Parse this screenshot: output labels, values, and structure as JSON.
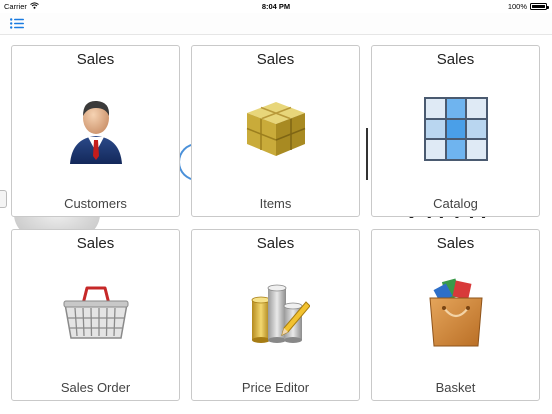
{
  "status_bar": {
    "carrier": "Carrier",
    "wifi_icon": "wifi-icon",
    "time": "8:04 PM",
    "battery_text": "100%",
    "battery_level": 1.0
  },
  "nav": {
    "menu_icon": "list-icon",
    "accent_color": "#1a7be0"
  },
  "background": {
    "year_text": "2016"
  },
  "tiles": [
    {
      "title": "Sales",
      "label": "Customers",
      "icon": "customer-icon"
    },
    {
      "title": "Sales",
      "label": "Items",
      "icon": "box-icon"
    },
    {
      "title": "Sales",
      "label": "Catalog",
      "icon": "catalog-grid-icon"
    },
    {
      "title": "Sales",
      "label": "Sales Order",
      "icon": "basket-icon"
    },
    {
      "title": "Sales",
      "label": "Price Editor",
      "icon": "coins-pencil-icon"
    },
    {
      "title": "Sales",
      "label": "Basket",
      "icon": "shopping-bag-icon"
    }
  ]
}
